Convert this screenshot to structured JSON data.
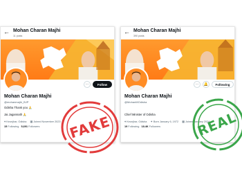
{
  "left_profile": {
    "topbar_name": "Mohan Charan Majhi",
    "posts": "11 posts",
    "name": "Mohan Charan Majhi",
    "handle": "@mohanmajhi_BJP",
    "bio": "Odisha Thank you 🙏",
    "bio2": "Jai Jagannath 🙏",
    "location": "Keonjhar, Odisha",
    "joined": "Joined November 2023",
    "following_count": "15",
    "following_label": "Following",
    "followers_count": "5,691",
    "followers_label": "Followers",
    "follow_button": "Follow",
    "more_icon": "more-icon",
    "stamp": "FAKE"
  },
  "right_profile": {
    "topbar_name": "Mohan Charan Majhi",
    "posts": "390 posts",
    "name": "Mohan Charan Majhi",
    "handle": "@MohanMOdisha",
    "bio": "Chief Minister of Odisha",
    "location": "Keonjhar, Odisha",
    "born": "Born January 6, 1972",
    "joined": "Joined January 2024",
    "following_count": "19",
    "following_label": "Following",
    "followers_count": "18.4K",
    "followers_label": "Followers",
    "following_button": "Following",
    "more_icon": "more-icon",
    "notify_icon": "notification-icon",
    "stamp": "REAL"
  },
  "colors": {
    "banner_orange": "#ff7b16",
    "fake_stamp": "#e23b3b",
    "real_stamp": "#3aa64a"
  }
}
